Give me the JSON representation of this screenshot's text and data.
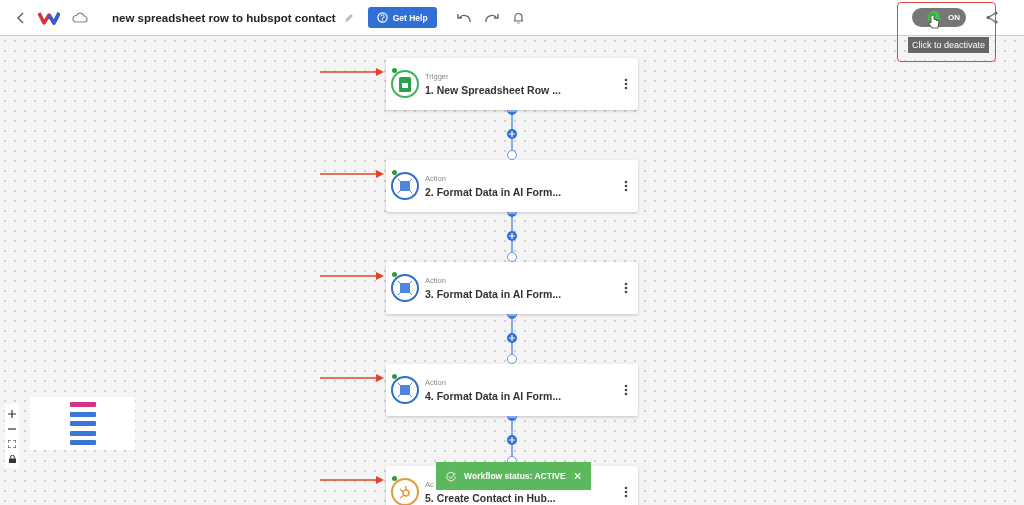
{
  "header": {
    "title": "new spreadsheet row to hubspot contact",
    "help_button": "Get Help"
  },
  "toggle": {
    "label": "ON",
    "on": true,
    "tooltip": "Click to deactivate"
  },
  "nodes": [
    {
      "kind": "sheets",
      "label": "Trigger",
      "title": "1. New Spreadsheet Row ..."
    },
    {
      "kind": "ai",
      "label": "Action",
      "title": "2. Format Data in AI Form..."
    },
    {
      "kind": "ai",
      "label": "Action",
      "title": "3. Format Data in AI Form..."
    },
    {
      "kind": "ai",
      "label": "Action",
      "title": "4. Format Data in AI Form..."
    },
    {
      "kind": "hubspot",
      "label": "Ac",
      "title": "5. Create Contact in Hub..."
    }
  ],
  "minimap": [
    {
      "color": "#d63384"
    },
    {
      "color": "#3a76d6"
    },
    {
      "color": "#3a76d6"
    },
    {
      "color": "#3a76d6"
    },
    {
      "color": "#3a76d6"
    }
  ],
  "toast": {
    "text": "Workflow status: ACTIVE"
  }
}
